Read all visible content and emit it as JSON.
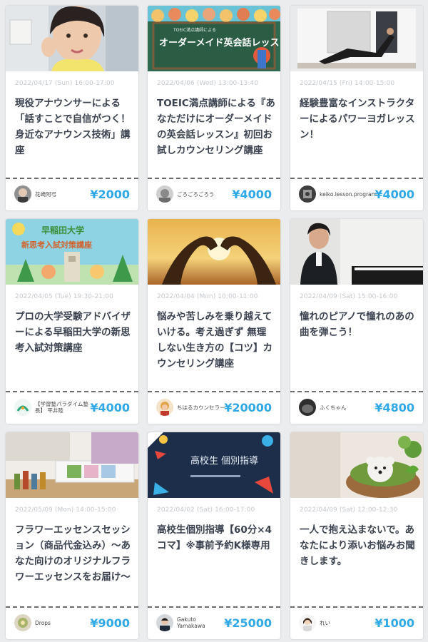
{
  "cards": [
    {
      "date": "2022/04/17 (Sun) 16:00-17:00",
      "title": "現役アナウンサーによる「話すことで自信がつく！身近なアナウンス技術」講座",
      "author": "花崎阿弓",
      "price": "¥2000"
    },
    {
      "date": "2022/04/06 (Wed) 13:00-13:40",
      "title": "TOEIC満点講師による『あなただけにオーダーメイドの英会話レッスン』初回お試しカウンセリング講座",
      "author": "ごろごろごろう",
      "price": "¥4000",
      "thumb_text": "オーダーメイド英会話レッスン",
      "thumb_small": "TOEIC満点講師による"
    },
    {
      "date": "2022/04/15 (Fri) 14:00-15:00",
      "title": "経験豊富なインストラクターによるパワーヨガレッスン！",
      "author": "keiko.lesson.program",
      "price": "¥4000"
    },
    {
      "date": "2022/04/05 (Tue) 19:30-21:00",
      "title": "プロの大学受験アドバイザーによる早稲田大学の新思考入試対策講座",
      "author": "【学習塾パラダイム塾長】 平井陸",
      "price": "¥4000",
      "thumb_text": "早稲田大学",
      "thumb_small": "新思考入試対策講座"
    },
    {
      "date": "2022/04/04 (Mon) 10:00-11:00",
      "title": "悩みや苦しみを乗り越えていける。考え過ぎず 無理しない生き方の【コツ】カウンセリング講座",
      "author": "ちはるカウンセラー",
      "price": "¥20000"
    },
    {
      "date": "2022/04/09 (Sat) 15:00-16:00",
      "title": "憧れのピアノで憧れのあの曲を弾こう！",
      "author": "ふくちゃん",
      "price": "¥4800"
    },
    {
      "date": "2022/05/09 (Mon) 14:00-15:00",
      "title": "フラワーエッセンスセッション（商品代金込み）～あなた向けのオリジナルフラワーエッセンスをお届け～",
      "author": "Drops",
      "price": "¥9000"
    },
    {
      "date": "2022/04/02 (Sat) 16:00-17:00",
      "title": "高校生個別指導【60分×4コマ】※事前予約K様専用",
      "author": "Gakuto Yamakawa",
      "price": "¥25000",
      "thumb_text": "高校生 個別指導"
    },
    {
      "date": "2022/04/09 (Sat) 12:00-12:30",
      "title": "一人で抱え込まないで。あなたにより添いお悩みお聞きします。",
      "author": "れい",
      "price": "¥1000"
    }
  ]
}
